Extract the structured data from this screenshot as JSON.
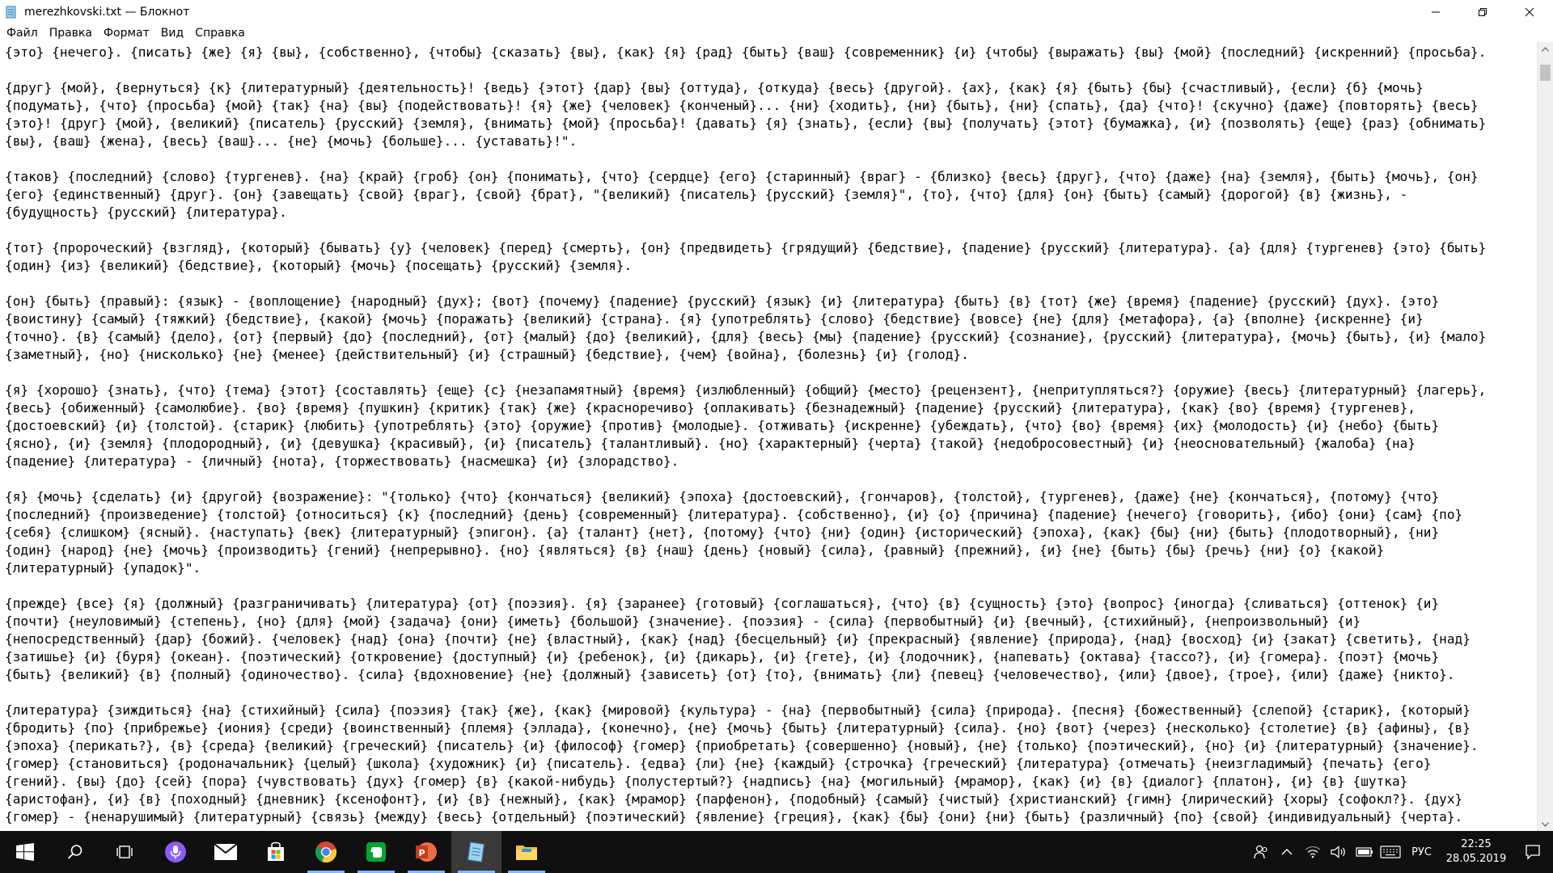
{
  "window": {
    "title": "merezhkovski.txt — Блокнот"
  },
  "menu": [
    {
      "label": "Файл"
    },
    {
      "label": "Правка"
    },
    {
      "label": "Формат"
    },
    {
      "label": "Вид"
    },
    {
      "label": "Справка"
    }
  ],
  "editor": {
    "text": "{это} {нечего}. {писать} {же} {я} {вы}, {собственно}, {чтобы} {сказать} {вы}, {как} {я} {рад} {быть} {ваш} {современник} {и} {чтобы} {выражать} {вы} {мой} {последний} {искренний} {просьба}.\n\n{друг} {мой}, {вернуться} {к} {литературный} {деятельность}! {ведь} {этот} {дар} {вы} {оттуда}, {откуда} {весь} {другой}. {ах}, {как} {я} {быть} {бы} {счастливый}, {если} {б} {мочь}\n{подумать}, {что} {просьба} {мой} {так} {на} {вы} {подействовать}! {я} {же} {человек} {конченый}... {ни} {ходить}, {ни} {быть}, {ни} {спать}, {да} {что}! {скучно} {даже} {повторять} {весь}\n{это}! {друг} {мой}, {великий} {писатель} {русский} {земля}, {внимать} {мой} {просьба}! {давать} {я} {знать}, {если} {вы} {получать} {этот} {бумажка}, {и} {позволять} {еще} {раз} {обнимать}\n{вы}, {ваш} {жена}, {весь} {ваш}... {не} {мочь} {больше}... {уставать}!\".\n\n{таков} {последний} {слово} {тургенев}. {на} {край} {гроб} {он} {понимать}, {что} {сердце} {его} {старинный} {враг} - {близко} {весь} {друг}, {что} {даже} {на} {земля}, {быть} {мочь}, {он}\n{его} {единственный} {друг}. {он} {завещать} {свой} {враг}, {свой} {брат}, \"{великий} {писатель} {русский} {земля}\", {то}, {что} {для} {он} {быть} {самый} {дорогой} {в} {жизнь}, -\n{будущность} {русский} {литература}.\n\n{тот} {пророческий} {взгляд}, {который} {бывать} {у} {человек} {перед} {смерть}, {он} {предвидеть} {грядущий} {бедствие}, {падение} {русский} {литература}. {а} {для} {тургенев} {это} {быть}\n{один} {из} {великий} {бедствие}, {который} {мочь} {посещать} {русский} {земля}.\n\n{он} {быть} {правый}: {язык} - {воплощение} {народный} {дух}; {вот} {почему} {падение} {русский} {язык} {и} {литература} {быть} {в} {тот} {же} {время} {падение} {русский} {дух}. {это}\n{воистину} {самый} {тяжкий} {бедствие}, {какой} {мочь} {поражать} {великий} {страна}. {я} {употреблять} {слово} {бедствие} {вовсе} {не} {для} {метафора}, {а} {вполне} {искренне} {и}\n{точно}. {в} {самый} {дело}, {от} {первый} {до} {последний}, {от} {малый} {до} {великий}, {для} {весь} {мы} {падение} {русский} {сознание}, {русский} {литература}, {мочь} {быть}, {и} {мало}\n{заметный}, {но} {нисколько} {не} {менее} {действительный} {и} {страшный} {бедствие}, {чем} {война}, {болезнь} {и} {голод}.\n\n{я} {хорошо} {знать}, {что} {тема} {этот} {составлять} {еще} {с} {незапамятный} {время} {излюбленный} {общий} {место} {рецензент}, {непритупляться?} {оружие} {весь} {литературный} {лагерь},\n{весь} {обиженный} {самолюбие}. {во} {время} {пушкин} {критик} {так} {же} {красноречиво} {оплакивать} {безнадежный} {падение} {русский} {литература}, {как} {во} {время} {тургенев},\n{достоевский} {и} {толстой}. {старик} {любить} {употреблять} {это} {оружие} {против} {молодые}. {отживать} {искренне} {убеждать}, {что} {во} {время} {их} {молодость} {и} {небо} {быть}\n{ясно}, {и} {земля} {плодородный}, {и} {девушка} {красивый}, {и} {писатель} {талантливый}. {но} {характерный} {черта} {такой} {недобросовестный} {и} {неосновательный} {жалоба} {на}\n{падение} {литература} - {личный} {нота}, {торжествовать} {насмешка} {и} {злорадство}.\n\n{я} {мочь} {сделать} {и} {другой} {возражение}: \"{только} {что} {кончаться} {великий} {эпоха} {достоевский}, {гончаров}, {толстой}, {тургенев}, {даже} {не} {кончаться}, {потому} {что}\n{последний} {произведение} {толстой} {относиться} {к} {последний} {день} {современный} {литература}. {собственно}, {и} {о} {причина} {падение} {нечего} {говорить}, {ибо} {они} {сам} {по}\n{себя} {слишком} {ясный}. {наступать} {век} {литературный} {эпигон}. {а} {талант} {нет}, {потому} {что} {ни} {один} {исторический} {эпоха}, {как} {бы} {ни} {быть} {плодотворный}, {ни}\n{один} {народ} {не} {мочь} {производить} {гений} {непрерывно}. {но} {являться} {в} {наш} {день} {новый} {сила}, {равный} {прежний}, {и} {не} {быть} {бы} {речь} {ни} {о} {какой}\n{литературный} {упадок}\".\n\n{прежде} {все} {я} {должный} {разграничивать} {литература} {от} {поэзия}. {я} {заранее} {готовый} {соглашаться}, {что} {в} {сущность} {это} {вопрос} {иногда} {сливаться} {оттенок} {и}\n{почти} {неуловимый} {степень}, {но} {для} {мой} {задача} {они} {иметь} {большой} {значение}. {поэзия} - {сила} {первобытный} {и} {вечный}, {стихийный}, {непроизвольный} {и}\n{непосредственный} {дар} {божий}. {человек} {над} {она} {почти} {не} {властный}, {как} {над} {бесцельный} {и} {прекрасный} {явление} {природа}, {над} {восход} {и} {закат} {светить}, {над}\n{затишье} {и} {буря} {океан}. {поэтический} {откровение} {доступный} {и} {ребенок}, {и} {дикарь}, {и} {гете}, {и} {лодочник}, {напевать} {октава} {тассо?}, {и} {гомера}. {поэт} {мочь}\n{быть} {великий} {в} {полный} {одиночество}. {сила} {вдохновение} {не} {должный} {зависеть} {от} {то}, {внимать} {ли} {певец} {человечество}, {или} {двое}, {трое}, {или} {даже} {никто}.\n\n{литература} {зиждиться} {на} {стихийный} {сила} {поэзия} {так} {же}, {как} {мировой} {культура} - {на} {первобытный} {сила} {природа}. {песня} {божественный} {слепой} {старик}, {который}\n{бродить} {по} {прибрежье} {иония} {среди} {воинственный} {племя} {эллада}, {конечно}, {не} {мочь} {быть} {литературный} {сила}. {но} {вот} {через} {несколько} {столетие} {в} {афины}, {в}\n{эпоха} {перикать?}, {в} {среда} {великий} {греческий} {писатель} {и} {философ} {гомер} {приобретать} {совершенно} {новый}, {не} {только} {поэтический}, {но} {и} {литературный} {значение}.\n{гомер} {становиться} {родоначальник} {целый} {школа} {художник} {и} {писатель}. {едва} {ли} {не} {каждый} {строчка} {греческий} {литература} {отмечать} {неизгладимый} {печать} {его}\n{гений}. {вы} {до} {сей} {пора} {чувствовать} {дух} {гомер} {в} {какой-нибудь} {полустертый?} {надпись} {на} {могильный} {мрамор}, {как} {и} {в} {диалог} {платон}, {и} {в} {шутка}\n{аристофан}, {и} {в} {походный} {дневник} {ксенофонт}, {и} {в} {нежный}, {как} {мрамор} {парфенон}, {подобный} {самый} {чистый} {христианский} {гимн} {лирический} {хоры} {софокл?}. {дух}\n{гомер} - {ненарушимый} {литературный} {связь} {между} {весь} {отдельный} {поэтический} {явление} {греция}, {как} {бы} {они} {ни} {быть} {различный} {по} {свой} {индивидуальный} {черта}."
  },
  "taskbar": {
    "apps": [
      {
        "icon": "windows-start-icon"
      },
      {
        "icon": "search-icon"
      },
      {
        "icon": "task-view-icon"
      },
      {
        "icon": "cortana-icon"
      },
      {
        "icon": "mail-icon"
      },
      {
        "icon": "store-icon"
      },
      {
        "icon": "chrome-icon"
      },
      {
        "icon": "evernote-icon"
      },
      {
        "icon": "powerpoint-icon"
      },
      {
        "icon": "notepad-icon"
      },
      {
        "icon": "file-explorer-icon"
      }
    ],
    "tray_lang": "РУС",
    "time": "22:25",
    "date": "28.05.2019"
  },
  "colors": {
    "taskbar": "#101010",
    "accent": "#8ab4f8"
  }
}
